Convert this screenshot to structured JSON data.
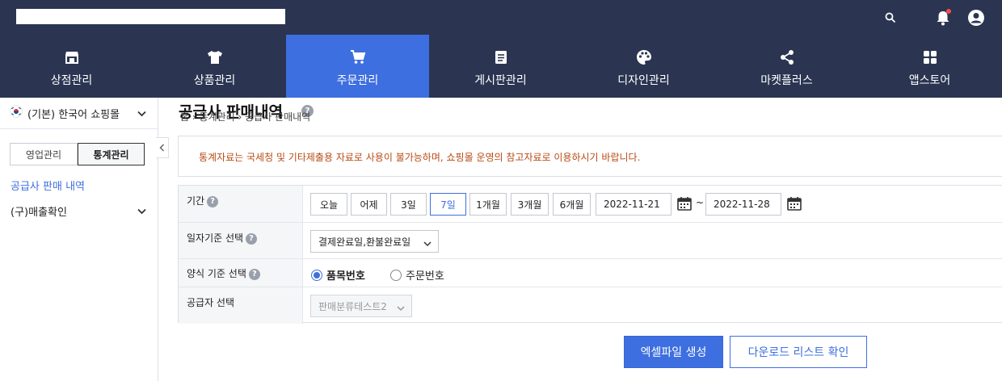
{
  "nav": {
    "items": [
      {
        "label": "상점관리",
        "icon": "store-icon"
      },
      {
        "label": "상품관리",
        "icon": "tshirt-icon"
      },
      {
        "label": "주문관리",
        "icon": "cart-icon"
      },
      {
        "label": "게시판관리",
        "icon": "board-icon"
      },
      {
        "label": "디자인관리",
        "icon": "palette-icon"
      },
      {
        "label": "마켓플러스",
        "icon": "share-icon"
      },
      {
        "label": "앱스토어",
        "icon": "apps-icon"
      }
    ],
    "active_index": 2
  },
  "colors": {
    "nav_bg": "#2b3552",
    "accent": "#3e6fe0",
    "notice_text": "#b84a14"
  },
  "sidebar": {
    "mall": "(기본) 한국어 쇼핑몰",
    "tabs": [
      "영업관리",
      "통계관리"
    ],
    "active_tab": 1,
    "current_link": "공급사 판매 내역",
    "group": "(구)매출확인"
  },
  "page": {
    "title": "공급사 판매내역",
    "breadcrumb": [
      "홈",
      "통계관리",
      "공급사 판매내역"
    ],
    "notice": "통계자료는 국세청 및 기타제출용 자료로 사용이 불가능하며, 쇼핑몰 운영의 참고자료로 이용하시기 바랍니다."
  },
  "form": {
    "period": {
      "label": "기간",
      "presets": [
        "오늘",
        "어제",
        "3일",
        "7일",
        "1개월",
        "3개월",
        "6개월"
      ],
      "selected_index": 3,
      "start_date": "2022-11-21",
      "end_date": "2022-11-28",
      "separator": "~"
    },
    "date_basis": {
      "label": "일자기준 선택",
      "value": "결제완료일,환불완료일"
    },
    "format_basis": {
      "label": "양식 기준 선택",
      "options": [
        "품목번호",
        "주문번호"
      ],
      "selected_index": 0
    },
    "supplier": {
      "label": "공급자 선택",
      "value": "판매분류테스트2"
    }
  },
  "actions": {
    "create_excel": "엑셀파일 생성",
    "download_list": "다운로드 리스트 확인"
  }
}
